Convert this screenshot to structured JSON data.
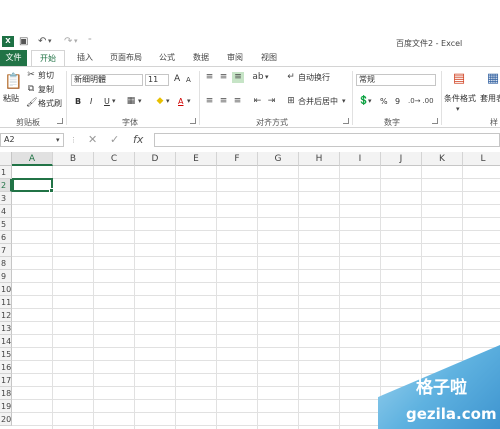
{
  "window": {
    "title": "百度文件2 - Excel"
  },
  "tabs": [
    "文件",
    "开始",
    "插入",
    "页面布局",
    "公式",
    "数据",
    "审阅",
    "视图"
  ],
  "ribbon": {
    "clipboard": {
      "paste": "粘贴",
      "cut": "剪切",
      "copy": "复制",
      "format_painter": "格式刷",
      "label": "剪贴板"
    },
    "font": {
      "name": "新细明體",
      "size": "11",
      "bold": "B",
      "italic": "I",
      "underline": "U",
      "grow": "A",
      "shrink": "A",
      "font_color": "A",
      "label": "字体"
    },
    "alignment": {
      "wrap": "自动换行",
      "merge": "合并后居中",
      "label": "对齐方式"
    },
    "number": {
      "format": "常规",
      "percent": "%",
      "comma": "9",
      "label": "数字"
    },
    "styles": {
      "conditional": "条件格式",
      "table": "套用表格格",
      "label": "样"
    }
  },
  "formula_bar": {
    "name_box": "A2",
    "cancel": "✕",
    "enter": "✓",
    "fx": "fx",
    "value": ""
  },
  "sheet": {
    "columns": [
      "A",
      "B",
      "C",
      "D",
      "E",
      "F",
      "G",
      "H",
      "I",
      "J",
      "K",
      "L"
    ],
    "rows": [
      "1",
      "2",
      "3",
      "4",
      "5",
      "6",
      "7",
      "8",
      "9",
      "10",
      "11",
      "12",
      "13",
      "14",
      "15",
      "16",
      "17",
      "18",
      "19",
      "20"
    ],
    "selected_cell": "A2"
  },
  "watermark": {
    "title": "格子啦",
    "url": "gezila.com"
  },
  "colors": {
    "accent": "#217346",
    "annotation": "#e02020"
  }
}
